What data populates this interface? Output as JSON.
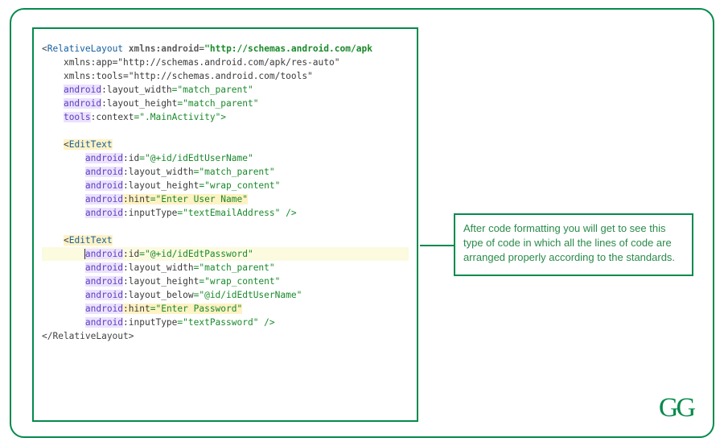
{
  "callout": {
    "text": "After code formatting you will get to see this type of code in which all the lines of code are arranged properly according to the standards."
  },
  "logo": {
    "text": "GG"
  },
  "code": {
    "rootTag": "RelativeLayout",
    "tag1": "EditText",
    "tag2": "EditText",
    "xmlns_android_ns": "xmlns:",
    "xmlns_android_key": "android",
    "xmlns_android_val": "\"http://schemas.android.com/apk",
    "xmlns_app": "xmlns:app=\"http://schemas.android.com/apk/res-auto\"",
    "xmlns_tools": "xmlns:tools=\"http://schemas.android.com/tools\"",
    "ns_android": "android",
    "ns_tools": "tools",
    "attr_layout_width": ":layout_width",
    "attr_layout_height": ":layout_height",
    "attr_context": ":context",
    "attr_id": ":id",
    "attr_hint": ":hint",
    "attr_inputType": ":inputType",
    "attr_layout_below": ":layout_below",
    "val_match_parent": "=\"match_parent\"",
    "val_wrap_content": "=\"wrap_content\"",
    "val_context": "=\".MainActivity\">",
    "val_id_user": "=\"@+id/idEdtUserName\"",
    "val_id_pass": "=\"@+id/idEdtPassword\"",
    "val_hint_user": "=\"Enter User Name\"",
    "val_hint_pass": "=\"Enter Password\"",
    "val_email": "=\"textEmailAddress\" />",
    "val_textpass": "=\"textPassword\" />",
    "val_below": "=\"@id/idEdtUserName\"",
    "close_root": "</RelativeLayout>"
  }
}
